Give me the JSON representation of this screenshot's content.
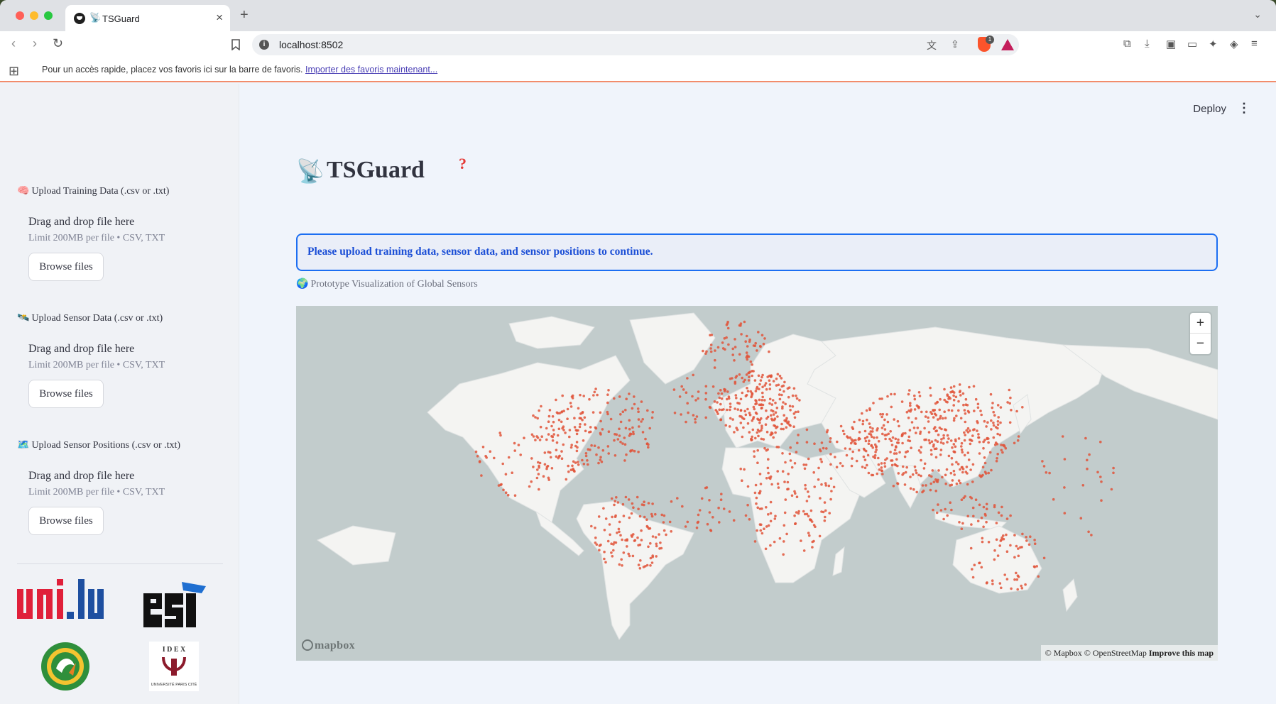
{
  "browser": {
    "tab_title": "TSGuard",
    "tab_icon": "📡",
    "url": "localhost:8502",
    "shield_count": "1",
    "bookmark_prompt": "Pour un accès rapide, placez vos favoris ici sur la barre de favoris.",
    "bookmark_link": "Importer des favoris maintenant..."
  },
  "header": {
    "deploy_label": "Deploy",
    "menu_glyph": "⋮"
  },
  "sidebar": {
    "uploads": [
      {
        "icon": "🧠",
        "label": "Upload Training Data (.csv or .txt)",
        "drop_title": "Drag and drop file here",
        "limit": "Limit 200MB per file • CSV, TXT",
        "button": "Browse files"
      },
      {
        "icon": "🛰️",
        "label": "Upload Sensor Data (.csv or .txt)",
        "drop_title": "Drag and drop file here",
        "limit": "Limit 200MB per file • CSV, TXT",
        "button": "Browse files"
      },
      {
        "icon": "🗺️",
        "label": "Upload Sensor Positions (.csv or .txt)",
        "drop_title": "Drag and drop file here",
        "limit": "Limit 200MB per file • CSV, TXT",
        "button": "Browse files"
      }
    ],
    "logos": {
      "uni": "uni.lu",
      "esi": "esi",
      "idex": "IDEX UNIVERSITÉ PARIS CITÉ"
    }
  },
  "main": {
    "title_icon": "📡",
    "title": "TSGuard",
    "help": "?",
    "alert": "Please upload training data, sensor data, and sensor positions to continue.",
    "map_caption_icon": "🌍",
    "map_caption": "Prototype Visualization of Global Sensors",
    "map": {
      "zoom_in": "+",
      "zoom_out": "−",
      "logo": "mapbox",
      "attribution": "© Mapbox © OpenStreetMap",
      "improve": "Improve this map",
      "point_color": "#e0533a",
      "land_color": "#f4f4f2",
      "water_color": "#c2cccc"
    }
  }
}
